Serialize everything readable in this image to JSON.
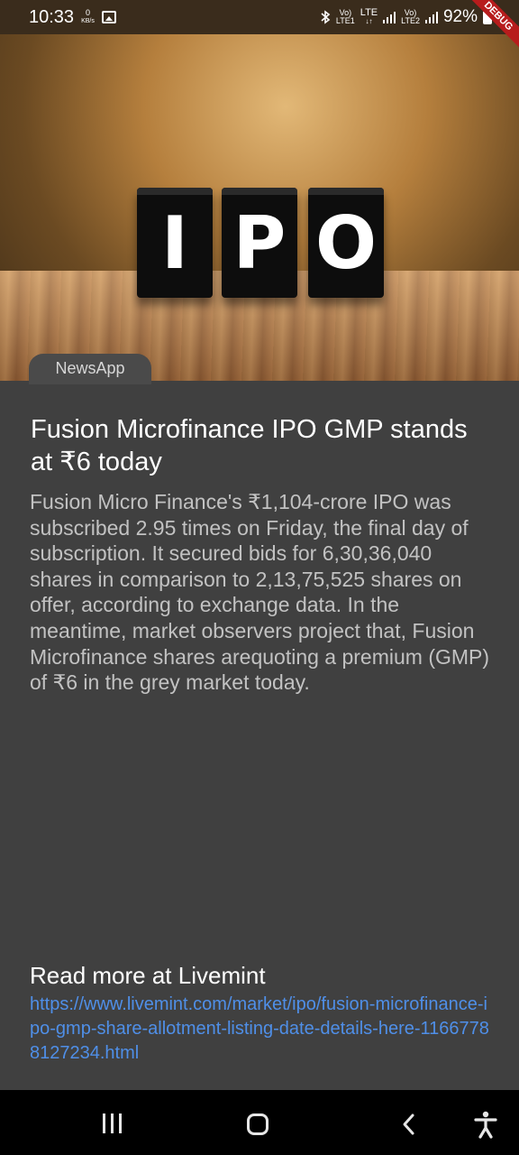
{
  "status_bar": {
    "time": "10:33",
    "data_speed_value": "0",
    "data_speed_unit": "KB/s",
    "sim1_label": "Vo)",
    "sim1_sub": "LTE1",
    "lte_label": "LTE",
    "sim2_label": "Vo)",
    "sim2_sub": "LTE2",
    "battery": "92%",
    "debug_banner": "DEBUG"
  },
  "hero": {
    "cube_letters": [
      "I",
      "P",
      "O"
    ]
  },
  "article": {
    "source": "NewsApp",
    "headline": "Fusion Microfinance IPO GMP stands at ₹6 today",
    "body": "Fusion Micro Finance's  ₹1,104-crore IPO was subscribed 2.95 times on Friday, the final day of subscription. It secured bids for 6,30,36,040 shares in comparison to 2,13,75,525 shares on offer, according to exchange data. In the meantime, market observers project that, Fusion Microfinance shares arequoting a premium (GMP) of ₹6 in the grey market today.",
    "read_more": "Read more at Livemint",
    "link": "https://www.livemint.com/market/ipo/fusion-microfinance-ipo-gmp-share-allotment-listing-date-details-here-11667788127234.html"
  },
  "nav": {
    "recents_icon": "recents-icon",
    "home_icon": "home-icon",
    "back_icon": "back-icon",
    "accessibility_icon": "accessibility-icon"
  }
}
